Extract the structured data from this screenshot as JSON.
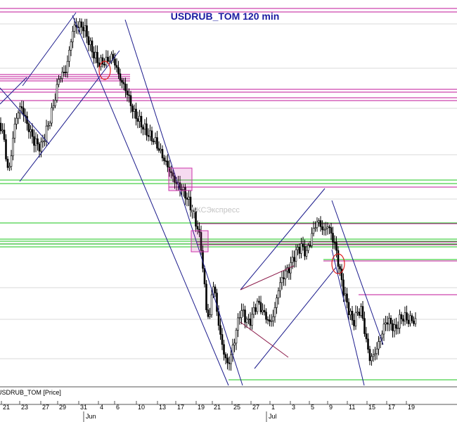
{
  "chart_data": {
    "type": "candlestick",
    "title": "USDRUB_TOM 120 min",
    "legend_label": "USDRUB_TOM [Price]",
    "watermark_text": "БКСЭкспресс",
    "x_tick_labels": [
      "21",
      "23",
      "27",
      "29",
      "31",
      "4",
      "6",
      "10",
      "13",
      "17",
      "19",
      "21",
      "25",
      "27",
      "1",
      "3",
      "5",
      "9",
      "11",
      "15",
      "17",
      "19"
    ],
    "month_labels": [
      "Jun",
      "Jul"
    ],
    "grid": true,
    "colors": {
      "candle": "#000000",
      "channel": "#1b1b8c",
      "resistance": "#c0169a",
      "support": "#18c418",
      "fan": "#8c1b4a",
      "highlight_box": "#cc33aa",
      "ellipse": "#dd2222"
    }
  }
}
